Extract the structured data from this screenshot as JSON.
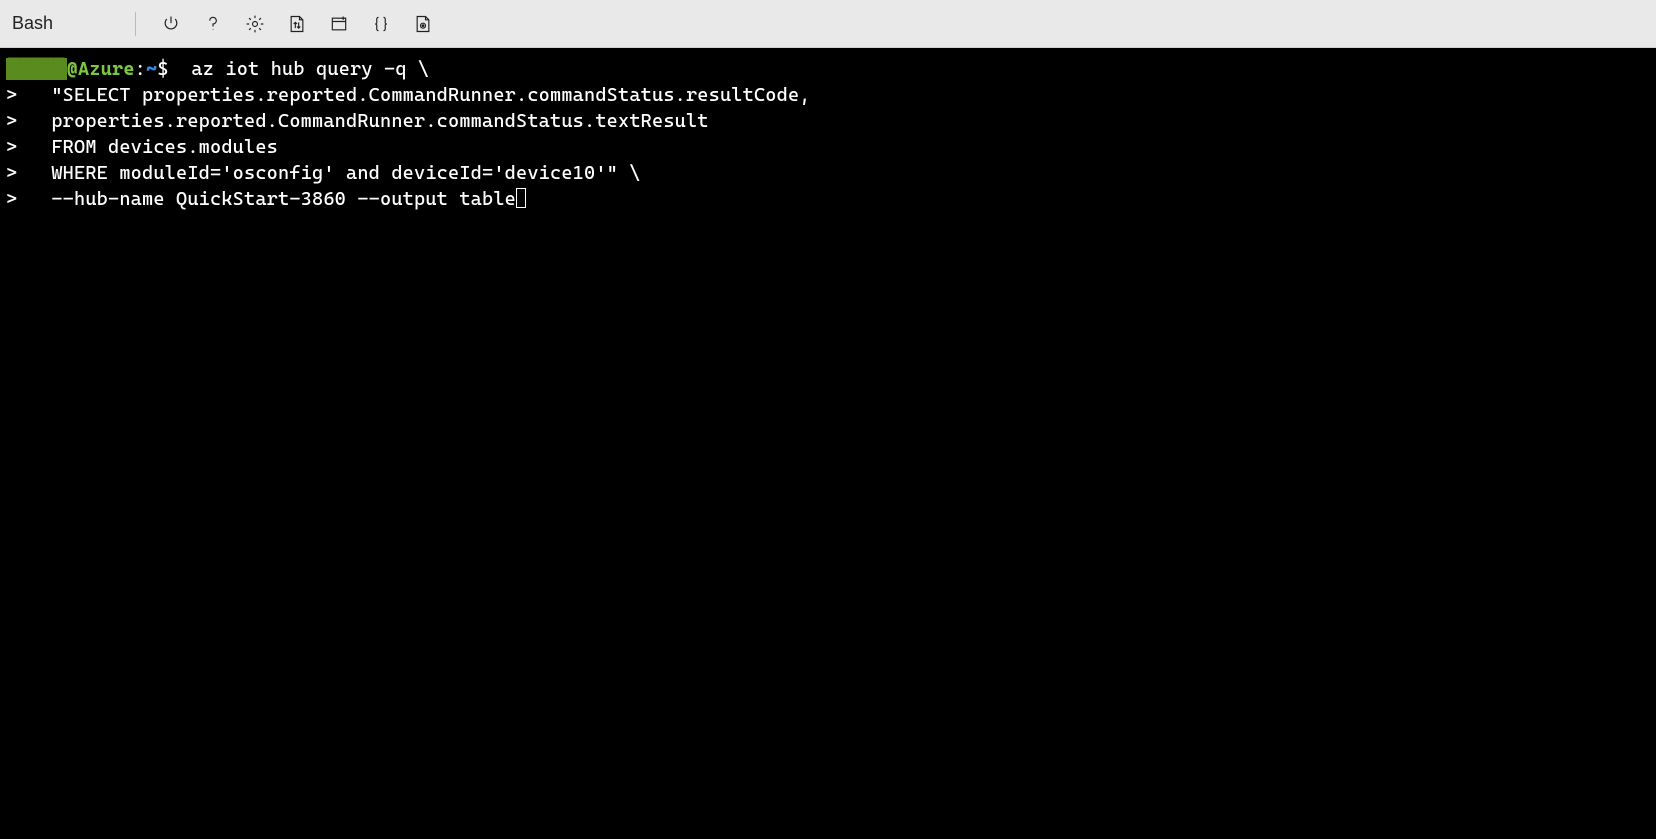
{
  "toolbar": {
    "shell_label": "Bash"
  },
  "prompt": {
    "user_hidden": "█████",
    "at_host": "@Azure",
    "colon": ":",
    "path": "~",
    "dollar": "$"
  },
  "terminal": {
    "line1_cmd": "  az iot hub query -q \\",
    "line2_prefix": ">",
    "line2_cmd": "   \"SELECT properties.reported.CommandRunner.commandStatus.resultCode,",
    "line3_prefix": ">",
    "line3_cmd": "   properties.reported.CommandRunner.commandStatus.textResult",
    "line4_prefix": ">",
    "line4_cmd": "   FROM devices.modules",
    "line5_prefix": ">",
    "line5_cmd": "   WHERE moduleId='osconfig' and deviceId='device10'\" \\",
    "line6_prefix": ">",
    "line6_cmd": "   --hub-name QuickStart-3860 --output table"
  }
}
